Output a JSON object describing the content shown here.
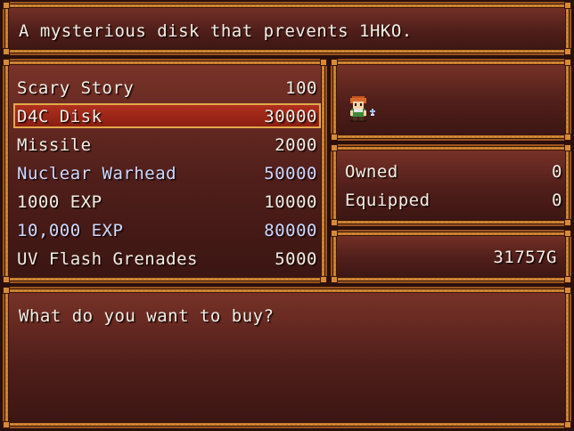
{
  "help": {
    "description": "A mysterious disk that prevents 1HKO."
  },
  "shop": {
    "items": [
      {
        "name": "Scary Story",
        "price": "100"
      },
      {
        "name": "D4C Disk",
        "price": "30000"
      },
      {
        "name": "Missile",
        "price": "2000"
      },
      {
        "name": "Nuclear Warhead",
        "price": "50000"
      },
      {
        "name": "1000 EXP",
        "price": "10000"
      },
      {
        "name": "10,000 EXP",
        "price": "80000"
      },
      {
        "name": "UV Flash Grenades",
        "price": "5000"
      }
    ],
    "selected_index": 1
  },
  "possession": {
    "owned_label": "Owned",
    "owned_value": "0",
    "equipped_label": "Equipped",
    "equipped_value": "0"
  },
  "gold": {
    "amount": "31757G"
  },
  "message": {
    "prompt": "What do you want to buy?"
  },
  "colors": {
    "window_top": "#7a3328",
    "window_bottom": "#3a1512",
    "frame": "#c47a2c",
    "selection": "#b0301e",
    "text": "#f4eee4",
    "highlight_text": "#cfd9ff"
  },
  "icons": {
    "actor": "party-leader-sprite"
  }
}
